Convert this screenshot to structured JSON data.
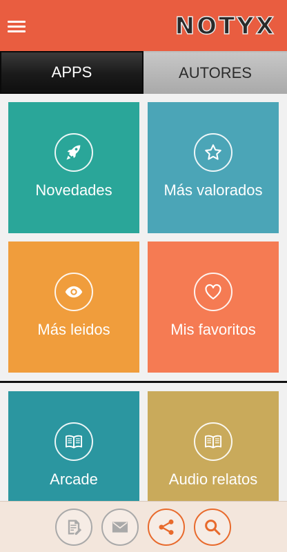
{
  "header": {
    "logo_text": "NOTYX",
    "menu_icon": "hamburger-menu-icon"
  },
  "tabs": [
    {
      "label": "APPS",
      "active": true
    },
    {
      "label": "AUTORES",
      "active": false
    }
  ],
  "tiles": [
    {
      "label": "Novedades",
      "icon": "rocket-icon",
      "color": "#2aa699"
    },
    {
      "label": "Más valorados",
      "icon": "star-icon",
      "color": "#4ba5b7"
    },
    {
      "label": "Más leidos",
      "icon": "eye-icon",
      "color": "#f09d3c"
    },
    {
      "label": "Mis favoritos",
      "icon": "heart-icon",
      "color": "#f57b53"
    },
    {
      "label": "Arcade",
      "icon": "book-icon",
      "color": "#2b96a0"
    },
    {
      "label": "Audio relatos",
      "icon": "book-icon",
      "color": "#c9aa5b"
    }
  ],
  "bottom_bar": {
    "buttons": [
      {
        "icon": "edit-document-icon",
        "color": "#a9a9a9"
      },
      {
        "icon": "mail-icon",
        "color": "#a9a9a9"
      },
      {
        "icon": "share-icon",
        "color": "#e86a2c"
      },
      {
        "icon": "search-icon",
        "color": "#e86a2c"
      }
    ]
  },
  "colors": {
    "app_bar": "#e95d40",
    "accent": "#e86a2c"
  }
}
